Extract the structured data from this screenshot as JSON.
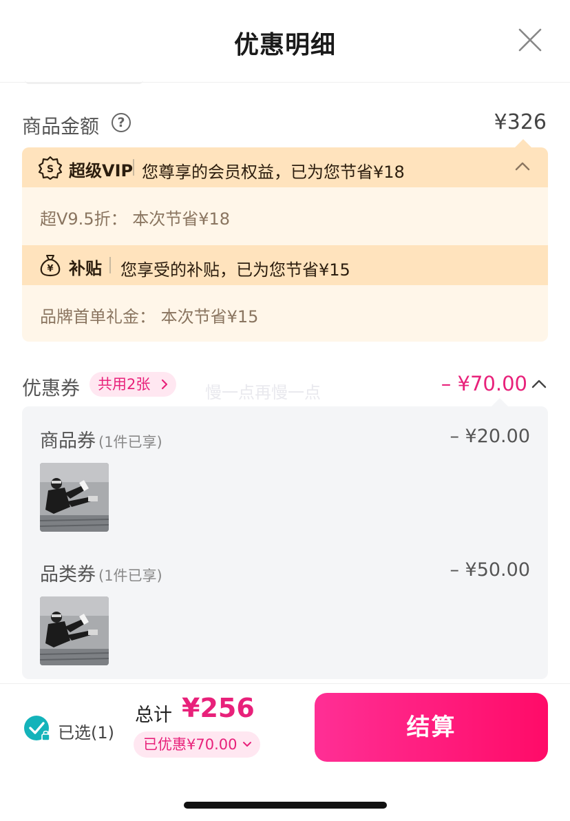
{
  "header": {
    "title": "优惠明细"
  },
  "goods": {
    "label": "商品金额",
    "help": "?",
    "value": "¥326"
  },
  "vip": {
    "tag": "超级VIP",
    "text": "您尊享的会员权益，已为您节省¥18",
    "detail": "超V9.5折：  本次节省¥18"
  },
  "subsidy": {
    "tag": "补贴",
    "text": "您享受的补贴，已为您节省¥15",
    "detail": "品牌首单礼金：  本次节省¥15"
  },
  "coupons": {
    "label": "优惠券",
    "shared": "共用2张",
    "watermark": "慢一点再慢一点",
    "total": "– ¥70.00",
    "items": [
      {
        "title": "商品券",
        "sub": "(1件已享)",
        "amount": "– ¥20.00"
      },
      {
        "title": "品类券",
        "sub": "(1件已享)",
        "amount": "– ¥50.00"
      }
    ]
  },
  "footer": {
    "selected": "已选(1)",
    "total_label": "总计",
    "total_value": "¥256",
    "discount": "已优惠¥70.00",
    "checkout": "结算"
  },
  "colors": {
    "accent": "#e8217a",
    "vip_band": "#ffe3bd",
    "benefit_bg": "#fff6e9",
    "coupon_bg": "#f4f5f7",
    "check": "#14b3ba"
  }
}
